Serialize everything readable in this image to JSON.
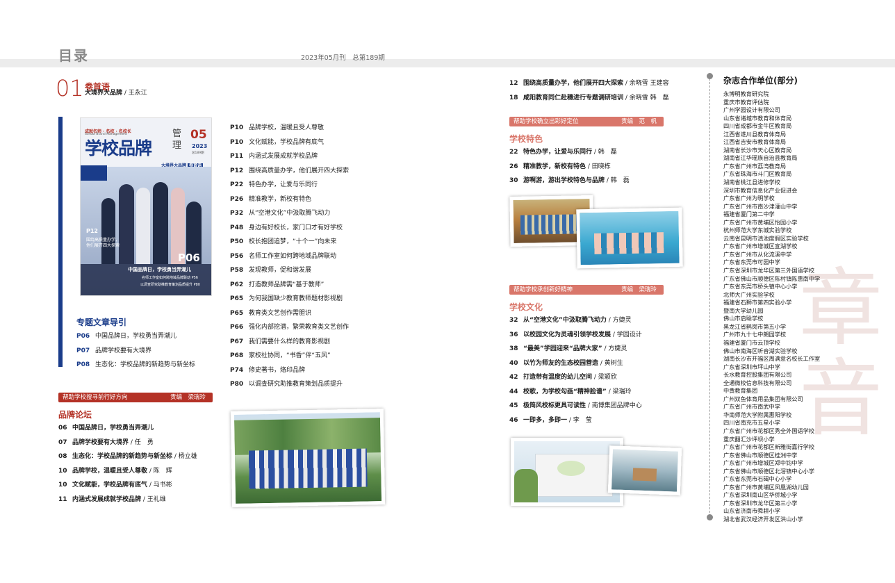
{
  "header": {
    "title": "目录",
    "issue": "2023年05月刊　总第189期"
  },
  "lead": {
    "number": "01",
    "section": "卷首语",
    "article": "大境界大品牌",
    "author": " / 王永江"
  },
  "cover": {
    "masthead_small": "成就名师 · 名校 · 名校长",
    "masthead_en": "School Brand Management",
    "title": "学校品牌",
    "title_side": "管理",
    "issue_no": "05",
    "year": "2023",
    "total": "总189期",
    "theme": "大境界大品牌",
    "theme_tag": "卷首语",
    "badge": "P12",
    "badge_text1": "围绕高质量办学，",
    "badge_text2": "他们展开四大探索",
    "p06": "P06",
    "headline": "中国品牌日，学校勇当弄潮儿",
    "sub1": "名师工作室如何跨地域品牌联动 P56",
    "sub2": "以调查研究助推教育策划品质提升 P80"
  },
  "cover_index": [
    {
      "page": "P10",
      "text": "品牌学校，温暖且受人尊敬"
    },
    {
      "page": "P10",
      "text": "文化赋能，学校品牌有底气"
    },
    {
      "page": "P11",
      "text": "内涵式发展成就学校品牌"
    },
    {
      "page": "P12",
      "text": "围绕高质量办学，他们展开四大探索"
    },
    {
      "page": "P22",
      "text": "特色办学，让爱与乐同行"
    },
    {
      "page": "P26",
      "text": "精准教学，新校有特色"
    },
    {
      "page": "P32",
      "text": "从“空港文化”中汲取腾飞动力"
    },
    {
      "page": "P48",
      "text": "身边有好校长，家门口才有好学校"
    },
    {
      "page": "P50",
      "text": "校长抱团追梦，“十个一”向未来"
    },
    {
      "page": "P56",
      "text": "名师工作室如何跨地域品牌联动"
    },
    {
      "page": "P58",
      "text": "发现教师，促和谐发展"
    },
    {
      "page": "P62",
      "text": "打造教师品牌需“基于教师”"
    },
    {
      "page": "P65",
      "text": "为何我国缺少教育教师题材影视剧"
    },
    {
      "page": "P65",
      "text": "教育类文艺创作需胆识"
    },
    {
      "page": "P66",
      "text": "强化内部挖潜，繁荣教育类文艺创作"
    },
    {
      "page": "P67",
      "text": "我们需要什么样的教育影视剧"
    },
    {
      "page": "P68",
      "text": "家校社协同，“书香”伴“五风”"
    },
    {
      "page": "P74",
      "text": "修史著书，烙印品牌"
    },
    {
      "page": "P80",
      "text": "以调查研究助推教育策划品质提升"
    }
  ],
  "special": {
    "title": "专题文章导引",
    "items": [
      {
        "page": "P06",
        "text": "中国品牌日，学校勇当弄潮儿"
      },
      {
        "page": "P07",
        "text": "品牌学校要有大境界"
      },
      {
        "page": "P08",
        "text": "生态化：学校品牌的新趋势与新坐标"
      }
    ]
  },
  "brand_forum": {
    "banner": "帮助学校搜寻前行好方向",
    "editor": "责编　梁瑞玲",
    "title": "品牌论坛",
    "items": [
      {
        "page": "06",
        "title": "中国品牌日，学校勇当弄潮儿",
        "author": ""
      },
      {
        "page": "07",
        "title": "品牌学校要有大境界",
        "author": " / 任　勇"
      },
      {
        "page": "08",
        "title": "生态化：学校品牌的新趋势与新坐标",
        "author": " / 杨立雄"
      },
      {
        "page": "10",
        "title": "品牌学校，温暖且受人尊敬",
        "author": " / 陈　辉"
      },
      {
        "page": "10",
        "title": "文化赋能，学校品牌有底气",
        "author": " / 马书彬"
      },
      {
        "page": "11",
        "title": "内涵式发展成就学校品牌",
        "author": " / 王礼维"
      }
    ]
  },
  "right_top": [
    {
      "page": "12",
      "title": "围绕高质量办学，他们展开四大探索",
      "author": " / 余晓雪  王建容"
    },
    {
      "page": "18",
      "title": "咸阳教育同仁赴穗进行专题调研培训",
      "author": " / 余晓雪  韩　磊"
    }
  ],
  "school_feature": {
    "banner": "帮助学校确立出彩好定位",
    "editor": "责编　范　帆",
    "title": "学校特色",
    "items": [
      {
        "page": "22",
        "title": "特色办学，让爱与乐同行",
        "author": " / 韩　磊"
      },
      {
        "page": "26",
        "title": "精准教学，新校有特色",
        "author": " / 田晓栋"
      },
      {
        "page": "30",
        "title": "游啊游，游出学校特色与品牌",
        "author": " / 韩　磊"
      }
    ]
  },
  "school_culture": {
    "banner": "帮助学校承创新好精神",
    "editor": "责编　梁瑞玲",
    "title": "学校文化",
    "items": [
      {
        "page": "32",
        "title": "从“空港文化”中汲取腾飞动力",
        "author": " / 方婕灵"
      },
      {
        "page": "36",
        "title": "以校园文化为灵魂引领学校发展",
        "author": " / 学园设计"
      },
      {
        "page": "38",
        "title": "“最美”学园迎来“品牌大家”",
        "author": " / 方婕灵"
      },
      {
        "page": "40",
        "title": "以竹为师友的生态校园营造",
        "author": " / 黄树生"
      },
      {
        "page": "42",
        "title": "打造带有温度的幼儿空间",
        "author": " / 梁颖欣"
      },
      {
        "page": "44",
        "title": "校歌，为学校勾画“精神脸谱”",
        "author": " / 梁瑞玲"
      },
      {
        "page": "45",
        "title": "极简风校标更具可读性",
        "author": " / 南博集团品牌中心"
      },
      {
        "page": "46",
        "title": "一即多，多即一",
        "author": " / 李　莹"
      }
    ]
  },
  "partners": {
    "title": "杂志合作单位(部分)",
    "list": [
      "永博明教育研究院",
      "重庆市教育评估院",
      "广州学园设计有限公司",
      "山东省诸城市教育和体育局",
      "四川省成都市金牛区教育局",
      "江西省遂川县教育体育局",
      "江西省吉安市教育体育局",
      "湖南省长沙市天心区教育局",
      "湖南省江华瑶族自治县教育局",
      "广东省广州市荔湾教育局",
      "广东省珠海市斗门区教育局",
      "湖南省桃江县进修学校",
      "深圳市教育信息化产业促进会",
      "广东省广州为明学校",
      "广东省广州市南沙津灌山中学",
      "福建省厦门第二中学",
      "广东省广州市黄埔区怡园小学",
      "杭州师范大学东城实验学校",
      "云南省昆明市滇池度假区实验学校",
      "广东省广州市增城区宣湖学校",
      "广东省广州市从化流溪中学",
      "广东省东莞市可园中学",
      "广东省深圳市龙华区第三外国语学校",
      "广东省佛山市顺德区陈村镇陈惠南中学",
      "广东省东莞市桥头镇中心小学",
      "北师大广州实验学校",
      "福建省石狮市第四实验小学",
      "暨南大学幼儿园",
      "佛山市启聪学校",
      "黑龙江省鹤岗市第五小学",
      "广州市九十七中朗园学校",
      "福建省厦门市云顶学校",
      "佛山市南海区听音湖实验学校",
      "湖南长沙市开福区周满意名校长工作室",
      "广东省深圳市坪山中学",
      "长水教育控股集团有限公司",
      "全通微校信息科技有限公司",
      "中黄教育集团",
      "广州双鱼体育用品集团有限公司",
      "广东省广州市南武中学",
      "华南师范大学附属惠阳学校",
      "四川省南充市五星小学",
      "广东省广州市花都区秀全外国语学校",
      "重庆翻汇沙坪坝小学",
      "广东省广州市花都区新雅街嘉行学校",
      "广东省佛山市顺德区桂洲中学",
      "广东省广州市增城区郑中钧中学",
      "广东省佛山市顺德区北滘镇中心小学",
      "广东省东莞市石碣中心小学",
      "广东省广州市黄埔区凤凰湖幼儿园",
      "广东省深圳南山区华侨城小学",
      "广东省深圳市龙华区第三小学",
      "山东省济南市舜耕小学",
      "湖北省武汉经济开发区洪山小学"
    ]
  },
  "colors": {
    "accent": "#b43226",
    "spine": "#1a3c8a",
    "band": "#ececec"
  }
}
